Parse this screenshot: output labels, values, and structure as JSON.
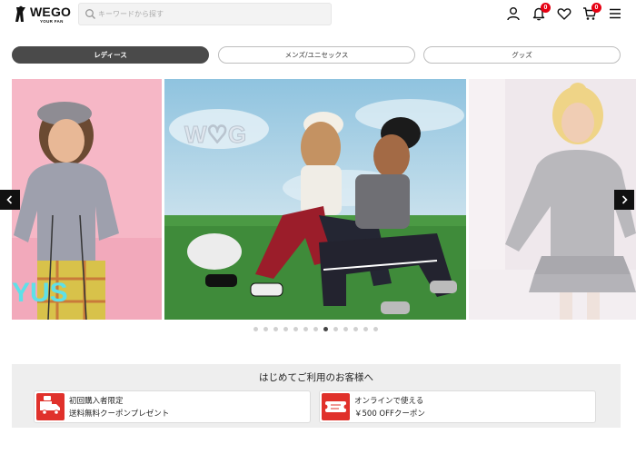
{
  "header": {
    "logo_text": "WEGO",
    "logo_subtext": "YOUR FAN",
    "search": {
      "placeholder": "キーワードから探す",
      "value": ""
    },
    "icons": [
      {
        "name": "user-icon"
      },
      {
        "name": "notification-bell-icon",
        "badge": "0"
      },
      {
        "name": "heart-icon"
      },
      {
        "name": "cart-icon",
        "badge": "0"
      },
      {
        "name": "menu-icon"
      }
    ]
  },
  "category_tabs": [
    {
      "label": "レディース",
      "active": true
    },
    {
      "label": "メンズ/ユニセックス",
      "active": false
    },
    {
      "label": "グッズ",
      "active": false
    }
  ],
  "carousel": {
    "slide_text": "YUS",
    "center_slide_text": "W♡G",
    "dots_count": 13,
    "active_dot": 7
  },
  "welcome": {
    "title": "はじめてご利用のお客様へ",
    "coupons": [
      {
        "line1": "初回購入者限定",
        "line2": "送料無料クーポンプレゼント",
        "icon": "delivery-truck-icon"
      },
      {
        "line1": "オンラインで使える",
        "line2": "￥500 OFFクーポン",
        "icon": "coupon-ticket-icon"
      }
    ]
  },
  "colors": {
    "accent": "#e60012",
    "tab_active": "#4a4a4a",
    "banner_bg": "#eeeeee"
  }
}
